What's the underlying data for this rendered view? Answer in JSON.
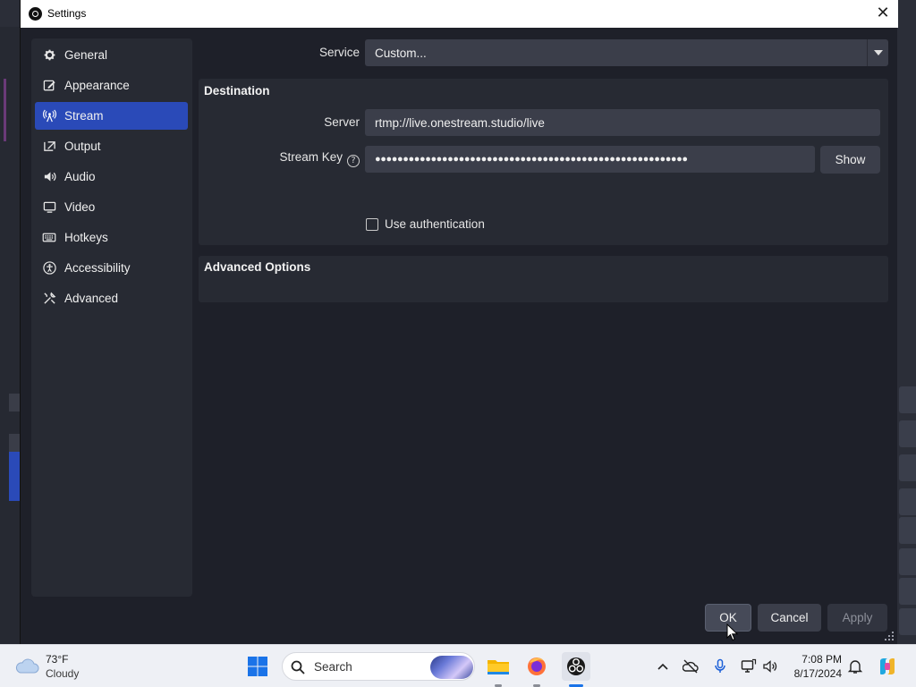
{
  "dialog": {
    "title": "Settings",
    "close_glyph": "✕"
  },
  "sidebar": {
    "items": [
      {
        "label": "General",
        "icon": "gear-icon"
      },
      {
        "label": "Appearance",
        "icon": "appearance-icon"
      },
      {
        "label": "Stream",
        "icon": "antenna-icon",
        "active": true
      },
      {
        "label": "Output",
        "icon": "output-icon"
      },
      {
        "label": "Audio",
        "icon": "speaker-icon"
      },
      {
        "label": "Video",
        "icon": "monitor-icon"
      },
      {
        "label": "Hotkeys",
        "icon": "keyboard-icon"
      },
      {
        "label": "Accessibility",
        "icon": "accessibility-icon"
      },
      {
        "label": "Advanced",
        "icon": "tools-icon"
      }
    ]
  },
  "stream": {
    "service_label": "Service",
    "service_value": "Custom...",
    "destination_title": "Destination",
    "server_label": "Server",
    "server_value": "rtmp://live.onestream.studio/live",
    "stream_key_label": "Stream Key",
    "stream_key_value": "●●●●●●●●●●●●●●●●●●●●●●●●●●●●●●●●●●●●●●●●●●●●●●●●●●●●●●●●",
    "show_label": "Show",
    "use_auth_label": "Use authentication",
    "use_auth_checked": false,
    "advanced_title": "Advanced Options"
  },
  "footer": {
    "ok_label": "OK",
    "cancel_label": "Cancel",
    "apply_label": "Apply"
  },
  "taskbar": {
    "weather_temp": "73°F",
    "weather_condition": "Cloudy",
    "search_placeholder": "Search",
    "time": "7:08 PM",
    "date": "8/17/2024"
  },
  "colors": {
    "accent": "#2a4ab8",
    "dialog_bg": "#1e2029",
    "panel_bg": "#272a33",
    "field_bg": "#3b3e4a"
  }
}
